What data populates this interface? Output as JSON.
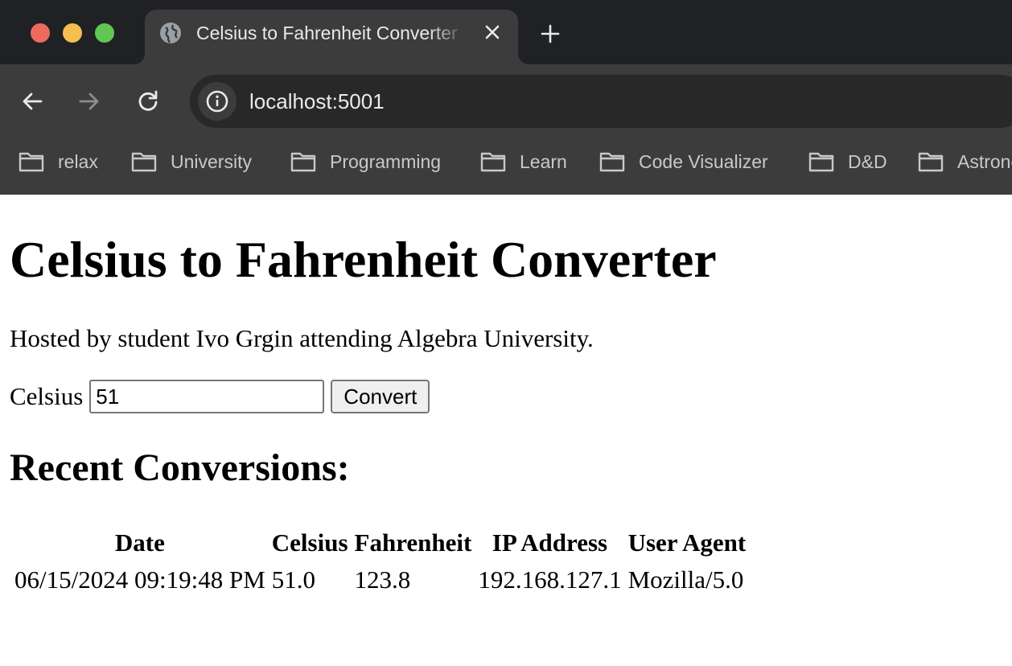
{
  "browser": {
    "tab_title": "Celsius to Fahrenheit Converter",
    "url": "localhost:5001",
    "bookmarks": [
      "relax",
      "University",
      "Programming",
      "Learn",
      "Code Visualizer",
      "D&D",
      "Astronomy"
    ]
  },
  "page": {
    "title": "Celsius to Fahrenheit Converter",
    "hosted_by": "Hosted by student Ivo Grgin attending Algebra University.",
    "celsius_label": "Celsius",
    "celsius_value": "51",
    "convert_label": "Convert",
    "recent_heading": "Recent Conversions:",
    "table": {
      "headers": [
        "Date",
        "Celsius",
        "Fahrenheit",
        "IP Address",
        "User Agent"
      ],
      "rows": [
        [
          "06/15/2024 09:19:48 PM",
          "51.0",
          "123.8",
          "192.168.127.1",
          "Mozilla/5.0"
        ]
      ]
    }
  }
}
